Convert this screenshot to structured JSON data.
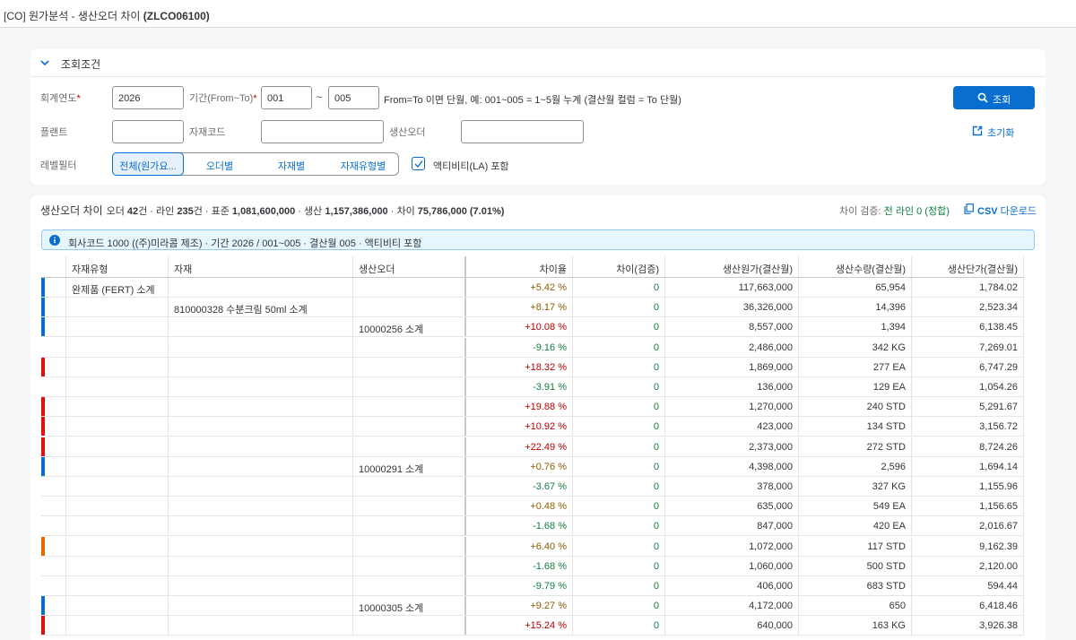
{
  "app": {
    "title_prefix": "[CO] 원가분석 - 생산오더 차이 ",
    "title_code": "(ZLCO06100)"
  },
  "filter": {
    "header": "조회조건",
    "fiscal_year_label": "회계연도",
    "fiscal_year_value": "2026",
    "period_label": "기간(From~To)",
    "period_from": "001",
    "period_tilde": "~",
    "period_to": "005",
    "period_hint": "From=To 이면 단월, 예: 001~005 = 1~5월 누계 (결산월 컬럼 = To 단월)",
    "plant_label": "플랜트",
    "material_label": "자재코드",
    "order_label": "생산오더",
    "level_label": "레벨필터",
    "segments": [
      "전체(원가요...",
      "오더별",
      "자재별",
      "자재유형별"
    ],
    "activity_label": "액티비티(LA) 포함",
    "search_label": "조회",
    "reset_label": "초기화"
  },
  "table": {
    "title": "생산오더 차이",
    "sum_order_prefix": "오더 ",
    "sum_order": "42",
    "sum_order_unit": "건 · 라인 ",
    "sum_line": "235",
    "sum_line_unit": "건 · 표준 ",
    "sum_std": "1,081,600,000",
    "sum_prod_prefix": " · 생산 ",
    "sum_prod": "1,157,386,000",
    "sum_diff_prefix": " · 차이 ",
    "sum_diff": "75,786,000 (7.01%)",
    "verify_label": "차이 검증: ",
    "verify_value": "전 라인 0 (정합)",
    "csv_prefix": "CSV",
    "csv_suffix": " 다운로드",
    "info": "회사코드 1000 ((주)미라콤 제조) · 기간 2026 / 001~005 · 결산월 005 · 액티비티 포함",
    "columns": [
      "자재유형",
      "자재",
      "생산오더",
      "차이율",
      "차이(검증)",
      "생산원가(결산월)",
      "생산수량(결산월)",
      "생산단가(결산월)"
    ],
    "rows": [
      {
        "mark": "#0a6ed1",
        "type": "완제품 (FERT) 소계",
        "material": "",
        "order": "",
        "rate": "+5.42 %",
        "tone": "pos-s",
        "check": "0",
        "cost": "117,663,000",
        "qty": "65,954",
        "unit": "1,784.02"
      },
      {
        "mark": "#0a6ed1",
        "type": "",
        "material": "810000328 수분크림 50ml 소계",
        "order": "",
        "rate": "+8.17 %",
        "tone": "pos-s",
        "check": "0",
        "cost": "36,326,000",
        "qty": "14,396",
        "unit": "2,523.34"
      },
      {
        "mark": "#0a6ed1",
        "type": "",
        "material": "",
        "order": "10000256 소계",
        "rate": "+10.08 %",
        "tone": "pos",
        "check": "0",
        "cost": "8,557,000",
        "qty": "1,394",
        "unit": "6,138.45"
      },
      {
        "mark": "",
        "type": "",
        "material": "",
        "order": "",
        "rate": "-9.16 %",
        "tone": "neg",
        "check": "0",
        "cost": "2,486,000",
        "qty": "342 KG",
        "unit": "7,269.01"
      },
      {
        "mark": "#e01010",
        "type": "",
        "material": "",
        "order": "",
        "rate": "+18.32 %",
        "tone": "pos",
        "check": "0",
        "cost": "1,869,000",
        "qty": "277 EA",
        "unit": "6,747.29"
      },
      {
        "mark": "",
        "type": "",
        "material": "",
        "order": "",
        "rate": "-3.91 %",
        "tone": "neg",
        "check": "0",
        "cost": "136,000",
        "qty": "129 EA",
        "unit": "1,054.26"
      },
      {
        "mark": "#e01010",
        "type": "",
        "material": "",
        "order": "",
        "rate": "+19.88 %",
        "tone": "pos",
        "check": "0",
        "cost": "1,270,000",
        "qty": "240 STD",
        "unit": "5,291.67"
      },
      {
        "mark": "#e01010",
        "type": "",
        "material": "",
        "order": "",
        "rate": "+10.92 %",
        "tone": "pos",
        "check": "0",
        "cost": "423,000",
        "qty": "134 STD",
        "unit": "3,156.72"
      },
      {
        "mark": "#e01010",
        "type": "",
        "material": "",
        "order": "",
        "rate": "+22.49 %",
        "tone": "pos",
        "check": "0",
        "cost": "2,373,000",
        "qty": "272 STD",
        "unit": "8,724.26"
      },
      {
        "mark": "#0a6ed1",
        "type": "",
        "material": "",
        "order": "10000291 소계",
        "rate": "+0.76 %",
        "tone": "pos-s",
        "check": "0",
        "cost": "4,398,000",
        "qty": "2,596",
        "unit": "1,694.14"
      },
      {
        "mark": "",
        "type": "",
        "material": "",
        "order": "",
        "rate": "-3.67 %",
        "tone": "neg",
        "check": "0",
        "cost": "378,000",
        "qty": "327 KG",
        "unit": "1,155.96"
      },
      {
        "mark": "",
        "type": "",
        "material": "",
        "order": "",
        "rate": "+0.48 %",
        "tone": "pos-s",
        "check": "0",
        "cost": "635,000",
        "qty": "549 EA",
        "unit": "1,156.65"
      },
      {
        "mark": "",
        "type": "",
        "material": "",
        "order": "",
        "rate": "-1.68 %",
        "tone": "neg",
        "check": "0",
        "cost": "847,000",
        "qty": "420 EA",
        "unit": "2,016.67"
      },
      {
        "mark": "#e06c00",
        "type": "",
        "material": "",
        "order": "",
        "rate": "+6.40 %",
        "tone": "pos-s",
        "check": "0",
        "cost": "1,072,000",
        "qty": "117 STD",
        "unit": "9,162.39"
      },
      {
        "mark": "",
        "type": "",
        "material": "",
        "order": "",
        "rate": "-1.68 %",
        "tone": "neg",
        "check": "0",
        "cost": "1,060,000",
        "qty": "500 STD",
        "unit": "2,120.00"
      },
      {
        "mark": "",
        "type": "",
        "material": "",
        "order": "",
        "rate": "-9.79 %",
        "tone": "neg",
        "check": "0",
        "cost": "406,000",
        "qty": "683 STD",
        "unit": "594.44"
      },
      {
        "mark": "#0a6ed1",
        "type": "",
        "material": "",
        "order": "10000305 소계",
        "rate": "+9.27 %",
        "tone": "pos-s",
        "check": "0",
        "cost": "4,172,000",
        "qty": "650",
        "unit": "6,418.46"
      },
      {
        "mark": "#e01010",
        "type": "",
        "material": "",
        "order": "",
        "rate": "+15.24 %",
        "tone": "pos",
        "check": "0",
        "cost": "640,000",
        "qty": "163 KG",
        "unit": "3,926.38"
      }
    ]
  }
}
